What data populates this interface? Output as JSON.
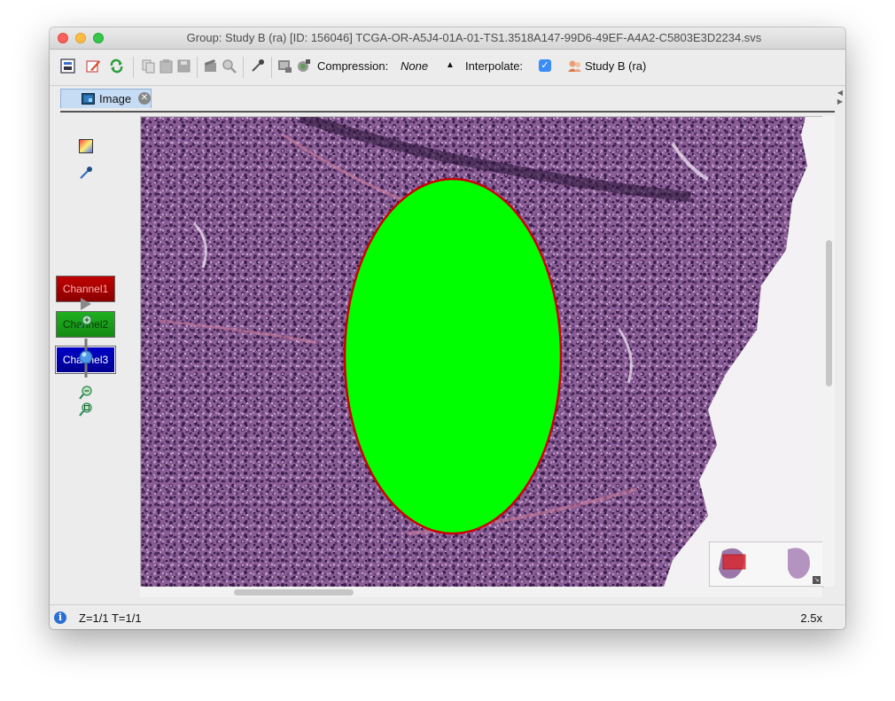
{
  "window": {
    "title": "Group: Study B (ra) [ID: 156046] TCGA-OR-A5J4-01A-01-TS1.3518A147-99D6-49EF-A4A2-C5803E3D2234.svs"
  },
  "toolbar": {
    "compression_label": "Compression:",
    "compression_value": "None",
    "interpolate_label": "Interpolate:",
    "interpolate_checked": true,
    "group_label": "Study B (ra)"
  },
  "tabs": [
    {
      "label": "Image"
    }
  ],
  "channels": [
    {
      "label": "Channel1",
      "color": "#c00000"
    },
    {
      "label": "Channel2",
      "color": "#20b020"
    },
    {
      "label": "Channel3",
      "color": "#0000c8"
    }
  ],
  "viewer": {
    "roi_shape": "ellipse",
    "roi_fill": "#00ff00",
    "roi_stroke": "#cc0000"
  },
  "status": {
    "position": "Z=1/1 T=1/1",
    "zoom": "2.5x"
  }
}
